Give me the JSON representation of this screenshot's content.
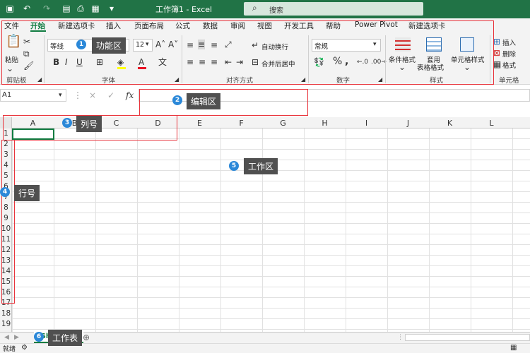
{
  "window": {
    "title": "工作簿1 - Excel",
    "search_placeholder": "搜索"
  },
  "ribbon_tabs": [
    "文件",
    "开始",
    "新建选项卡",
    "插入",
    "页面布局",
    "公式",
    "数据",
    "审阅",
    "视图",
    "开发工具",
    "帮助",
    "Power Pivot",
    "新建选项卡"
  ],
  "active_tab": "开始",
  "ribbon": {
    "clipboard": {
      "paste_label": "粘贴",
      "group_label": "剪贴板"
    },
    "font": {
      "font_name": "等线",
      "font_size": "12",
      "group_label": "字体"
    },
    "alignment": {
      "wrap_label": "自动换行",
      "merge_label": "合并后居中",
      "group_label": "对齐方式"
    },
    "number": {
      "format_value": "常规",
      "group_label": "数字"
    },
    "styles": {
      "conditional_label": "条件格式",
      "table_label_1": "套用",
      "table_label_2": "表格格式",
      "cell_style_label": "单元格样式",
      "group_label": "样式"
    },
    "cells": {
      "insert_label": "插入",
      "delete_label": "删除",
      "format_label": "格式",
      "group_label": "单元格"
    }
  },
  "formula_bar": {
    "name_box": "A1",
    "fx_label": "fx",
    "cancel_icon": "×",
    "enter_icon": "✓"
  },
  "grid": {
    "columns": [
      "A",
      "B",
      "C",
      "D",
      "E",
      "F",
      "G",
      "H",
      "I",
      "J",
      "K",
      "L"
    ],
    "rows": [
      "1",
      "2",
      "3",
      "4",
      "5",
      "6",
      "7",
      "8",
      "9",
      "10",
      "11",
      "12",
      "13",
      "14",
      "15",
      "16",
      "17",
      "18",
      "19"
    ]
  },
  "sheet_tab": "Sh",
  "status": {
    "ready": "就绪"
  },
  "annotations": [
    {
      "num": "1",
      "label": "功能区"
    },
    {
      "num": "2",
      "label": "编辑区"
    },
    {
      "num": "3",
      "label": "列号"
    },
    {
      "num": "4",
      "label": "行号"
    },
    {
      "num": "5",
      "label": "工作区"
    },
    {
      "num": "6",
      "label": "工作表"
    }
  ],
  "colors": {
    "excel_green": "#217346",
    "annotation_red": "#e8343c",
    "badge_blue": "#2b88d8",
    "callout_gray": "#505050"
  }
}
